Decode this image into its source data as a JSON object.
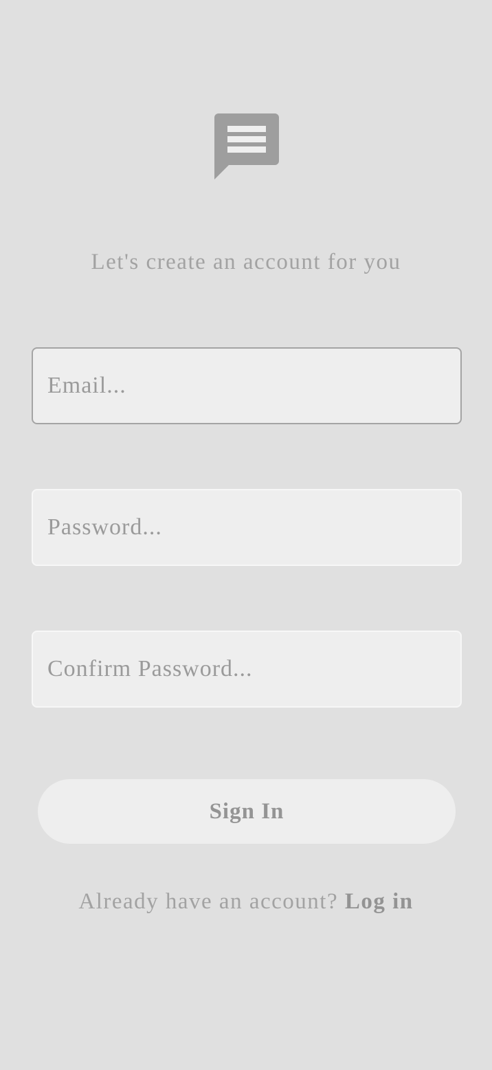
{
  "header": {
    "logo_icon": "message-square-icon",
    "subtitle": "Let's create an account for you"
  },
  "form": {
    "email": {
      "value": "",
      "placeholder": "Email..."
    },
    "password": {
      "value": "",
      "placeholder": "Password..."
    },
    "confirm_password": {
      "value": "",
      "placeholder": "Confirm Password..."
    },
    "submit_label": "Sign In"
  },
  "footer": {
    "prompt": "Already have an account?",
    "link_label": "Log in"
  },
  "colors": {
    "background": "#e0e0e0",
    "field_background": "#eeeeee",
    "icon": "#9e9e9e",
    "text_muted": "#a2a2a2"
  }
}
